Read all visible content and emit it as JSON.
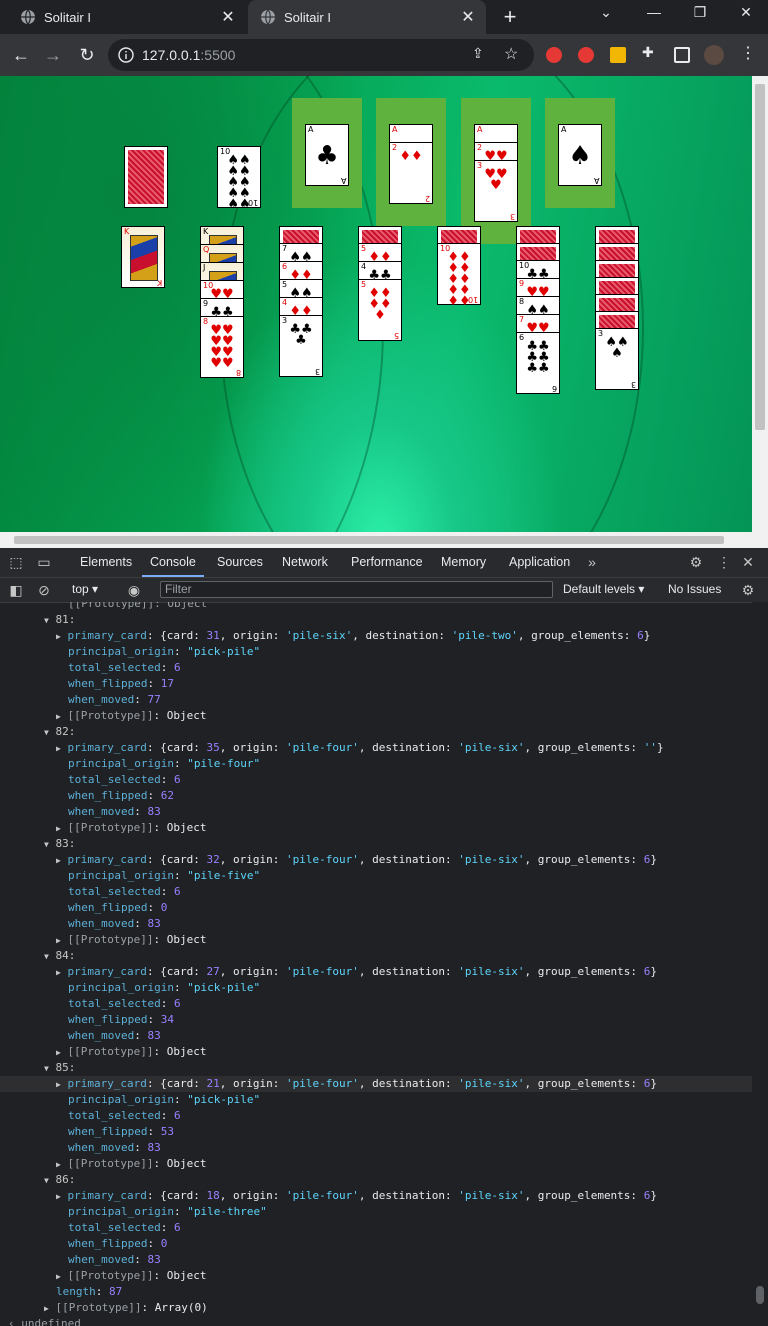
{
  "tabs": [
    {
      "title": "Solitair I",
      "state": "inactive"
    },
    {
      "title": "Solitair I",
      "state": "active"
    }
  ],
  "address": {
    "host": "127.0.0.1",
    "port": ":5500"
  },
  "game": {
    "stock": {
      "face_down": true
    },
    "waste": [
      {
        "rank": "10",
        "suit": "♠",
        "color": "black"
      }
    ],
    "foundations": [
      {
        "cards": [
          {
            "rank": "A",
            "suit": "♣",
            "color": "black"
          }
        ]
      },
      {
        "cards": [
          {
            "rank": "A",
            "suit": "♦",
            "color": "red"
          },
          {
            "rank": "2",
            "suit": "♦",
            "color": "red"
          }
        ]
      },
      {
        "cards": [
          {
            "rank": "A",
            "suit": "♥",
            "color": "red"
          },
          {
            "rank": "2",
            "suit": "♥",
            "color": "red"
          },
          {
            "rank": "3",
            "suit": "♥",
            "color": "red"
          }
        ]
      },
      {
        "cards": [
          {
            "rank": "A",
            "suit": "♠",
            "color": "black"
          }
        ]
      }
    ],
    "tableau": [
      {
        "down": 0,
        "up": [
          {
            "rank": "K",
            "suit": "♦",
            "color": "red"
          }
        ]
      },
      {
        "down": 0,
        "up": [
          {
            "rank": "K",
            "suit": "♣",
            "color": "black"
          },
          {
            "rank": "Q",
            "suit": "♥",
            "color": "red"
          },
          {
            "rank": "J",
            "suit": "♠",
            "color": "black"
          },
          {
            "rank": "10",
            "suit": "♥",
            "color": "red"
          },
          {
            "rank": "9",
            "suit": "♣",
            "color": "black"
          },
          {
            "rank": "8",
            "suit": "♥",
            "color": "red"
          }
        ]
      },
      {
        "down": 1,
        "up": [
          {
            "rank": "7",
            "suit": "♠",
            "color": "black"
          },
          {
            "rank": "6",
            "suit": "♦",
            "color": "red"
          },
          {
            "rank": "5",
            "suit": "♠",
            "color": "black"
          },
          {
            "rank": "4",
            "suit": "♦",
            "color": "red"
          },
          {
            "rank": "3",
            "suit": "♣",
            "color": "black"
          }
        ]
      },
      {
        "down": 1,
        "up": [
          {
            "rank": "5",
            "suit": "♦",
            "color": "red"
          },
          {
            "rank": "4",
            "suit": "♣",
            "color": "black"
          },
          {
            "rank": "5",
            "suit": "♦",
            "color": "red"
          }
        ]
      },
      {
        "down": 1,
        "up": [
          {
            "rank": "10",
            "suit": "♦",
            "color": "red"
          }
        ]
      },
      {
        "down": 2,
        "up": [
          {
            "rank": "10",
            "suit": "♣",
            "color": "black"
          },
          {
            "rank": "9",
            "suit": "♥",
            "color": "red"
          },
          {
            "rank": "8",
            "suit": "♠",
            "color": "black"
          },
          {
            "rank": "7",
            "suit": "♥",
            "color": "red"
          },
          {
            "rank": "6",
            "suit": "♣",
            "color": "black"
          }
        ]
      },
      {
        "down": 6,
        "up": [
          {
            "rank": "3",
            "suit": "♠",
            "color": "black"
          }
        ]
      }
    ]
  },
  "devtools": {
    "tabs": [
      "Elements",
      "Console",
      "Sources",
      "Network",
      "Performance",
      "Memory",
      "Application"
    ],
    "active_tab": "Console",
    "context": "top",
    "filter_placeholder": "Filter",
    "levels": "Default levels ▾",
    "issues": "No Issues"
  },
  "console_entries": [
    {
      "index": "81",
      "card": "31",
      "origin": "'pile-six'",
      "destination": "'pile-two'",
      "group_elements": "6",
      "principal_origin": "\"pick-pile\"",
      "total_selected": "6",
      "when_flipped": "17",
      "when_moved": "77"
    },
    {
      "index": "82",
      "card": "35",
      "origin": "'pile-four'",
      "destination": "'pile-six'",
      "group_elements": "''",
      "principal_origin": "\"pile-four\"",
      "total_selected": "6",
      "when_flipped": "62",
      "when_moved": "83"
    },
    {
      "index": "83",
      "card": "32",
      "origin": "'pile-four'",
      "destination": "'pile-six'",
      "group_elements": "6",
      "principal_origin": "\"pile-five\"",
      "total_selected": "6",
      "when_flipped": "0",
      "when_moved": "83"
    },
    {
      "index": "84",
      "card": "27",
      "origin": "'pile-four'",
      "destination": "'pile-six'",
      "group_elements": "6",
      "principal_origin": "\"pick-pile\"",
      "total_selected": "6",
      "when_flipped": "34",
      "when_moved": "83"
    },
    {
      "index": "85",
      "card": "21",
      "origin": "'pile-four'",
      "destination": "'pile-six'",
      "group_elements": "6",
      "principal_origin": "\"pick-pile\"",
      "total_selected": "6",
      "when_flipped": "53",
      "when_moved": "83"
    },
    {
      "index": "86",
      "card": "18",
      "origin": "'pile-four'",
      "destination": "'pile-six'",
      "group_elements": "6",
      "principal_origin": "\"pile-three\"",
      "total_selected": "6",
      "when_flipped": "0",
      "when_moved": "83"
    }
  ],
  "console_footer": {
    "length_label": "length",
    "length_value": "87",
    "proto_label": "[[Prototype]]",
    "proto_value": "Array(0)",
    "undefined_text": "undefined"
  },
  "labels": {
    "primary_card": "primary_card",
    "principal_origin": "principal_origin",
    "total_selected": "total_selected",
    "when_flipped": "when_flipped",
    "when_moved": "when_moved",
    "prototype": "[[Prototype]]",
    "object": "Object"
  }
}
